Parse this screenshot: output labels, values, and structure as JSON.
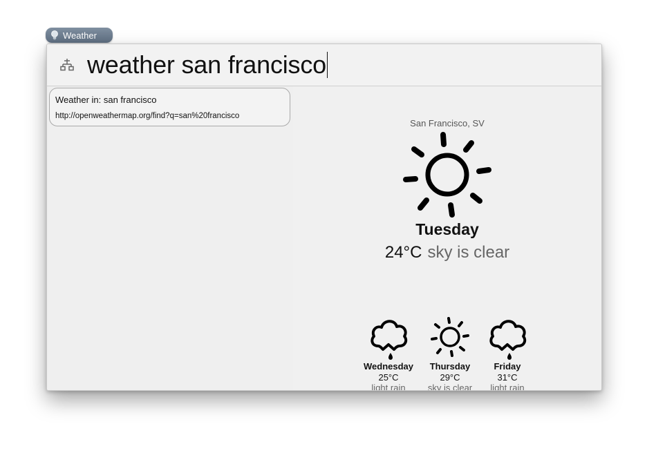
{
  "tab": {
    "label": "Weather",
    "icon": "lightbulb-icon"
  },
  "search": {
    "icon": "command-glyph-icon",
    "query": "weather san francisco"
  },
  "results": [
    {
      "title": "Weather in: san francisco",
      "url": "http://openweathermap.org/find?q=san%20francisco"
    }
  ],
  "weather": {
    "location": "San Francisco, SV",
    "current": {
      "day": "Tuesday",
      "temp": "24°C",
      "description": "sky is clear",
      "icon": "sun-icon"
    },
    "forecast": [
      {
        "day": "Wednesday",
        "temp": "25°C",
        "description": "light rain",
        "icon": "rain-cloud-icon"
      },
      {
        "day": "Thursday",
        "temp": "29°C",
        "description": "sky is clear",
        "icon": "sun-icon"
      },
      {
        "day": "Friday",
        "temp": "31°C",
        "description": "light rain",
        "icon": "rain-cloud-icon"
      }
    ]
  },
  "colors": {
    "tab_background": "#6a7a8c",
    "window_background": "#f0f0f0",
    "text": "#111111",
    "muted_text": "#666666"
  }
}
